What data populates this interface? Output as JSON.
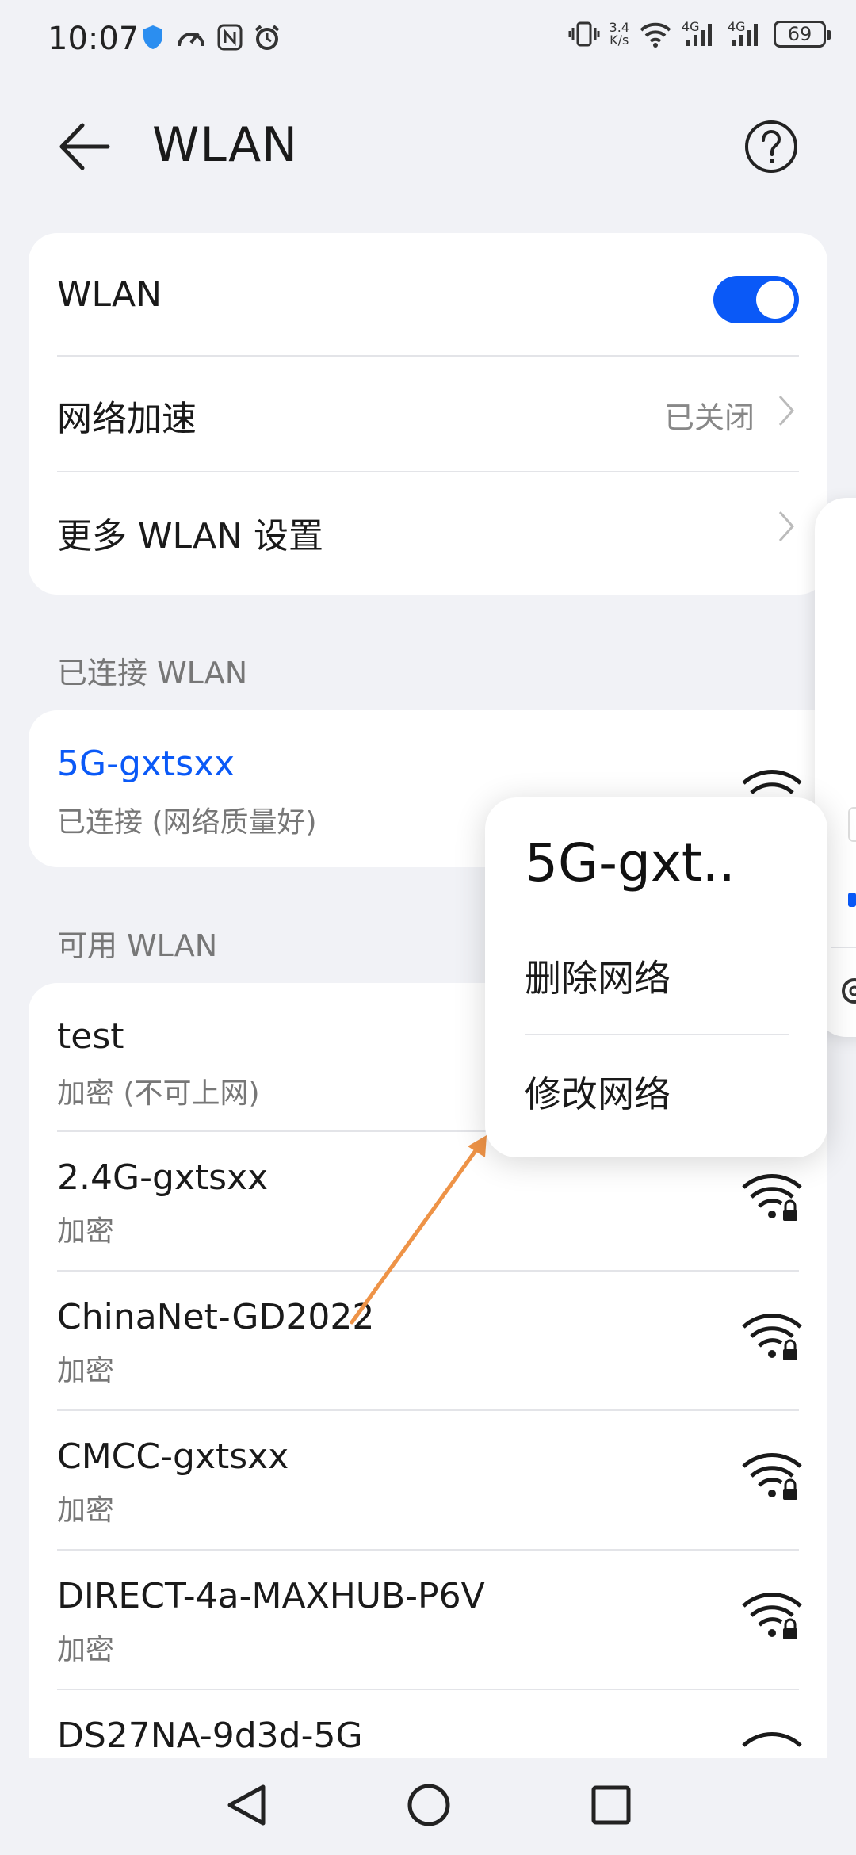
{
  "status_bar": {
    "time": "10:07",
    "net_speed_top": "3.4",
    "net_speed_bottom": "K/s",
    "sig1_label": "4G",
    "sig2_label": "4G",
    "battery": "69"
  },
  "header": {
    "title": "WLAN"
  },
  "settings_card": {
    "wlan_label": "WLAN",
    "wlan_enabled": true,
    "accel_label": "网络加速",
    "accel_value": "已关闭",
    "more_label": "更多 WLAN 设置"
  },
  "connected": {
    "section_title": "已连接 WLAN",
    "name": "5G-gxtsxx",
    "status": "已连接 (网络质量好)"
  },
  "available": {
    "section_title": "可用 WLAN",
    "networks": [
      {
        "name": "test",
        "status": "加密 (不可上网)"
      },
      {
        "name": "2.4G-gxtsxx",
        "status": "加密"
      },
      {
        "name": "ChinaNet-GD2022",
        "status": "加密"
      },
      {
        "name": "CMCC-gxtsxx",
        "status": "加密"
      },
      {
        "name": "DIRECT-4a-MAXHUB-P6V",
        "status": "加密"
      },
      {
        "name": "DS27NA-9d3d-5G",
        "status": ""
      }
    ]
  },
  "popup": {
    "title": "5G-gxt..",
    "delete_label": "删除网络",
    "modify_label": "修改网络"
  },
  "colors": {
    "accent": "#0a59f7",
    "arrow": "#ee9347",
    "background": "#f1f2f6"
  }
}
